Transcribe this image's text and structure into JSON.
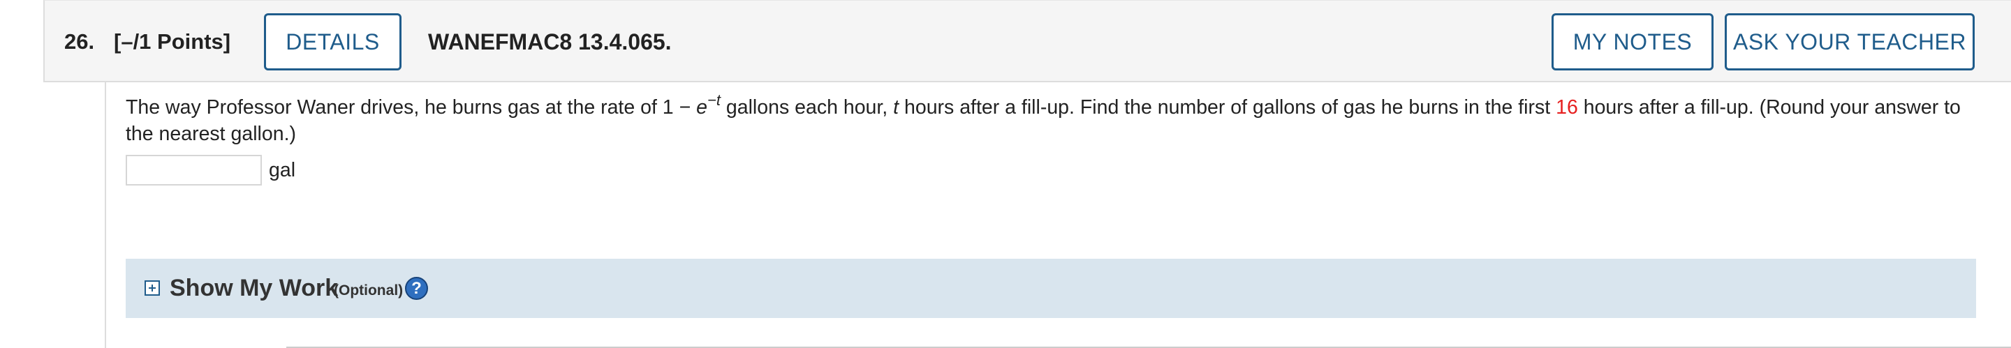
{
  "header": {
    "question_number": "26.",
    "points": "[–/1 Points]",
    "details_label": "DETAILS",
    "question_id": "WANEFMAC8 13.4.065.",
    "my_notes_label": "MY NOTES",
    "ask_teacher_label": "ASK YOUR TEACHER"
  },
  "question": {
    "text_part1": "The way Professor Waner drives, he burns gas at the rate of 1 − ",
    "e": "e",
    "exponent": "−t",
    "text_part2": " gallons each hour, ",
    "t": "t",
    "text_part3": " hours after a fill-up. Find the number of gallons of gas he burns in the first ",
    "highlight_value": "16",
    "text_part4": " hours after a fill-up. (Round your answer to the nearest gallon.)",
    "highlight_color": "#e62020"
  },
  "answer": {
    "value": "",
    "unit": "gal"
  },
  "show_work": {
    "label": "Show My Work",
    "optional": "(Optional)",
    "help_glyph": "?",
    "expand_icon": "plus-box-icon",
    "help_icon": "question-circle-icon"
  },
  "colors": {
    "accent": "#1f5c8b",
    "panel": "#d9e5ee",
    "header_bg": "#f5f5f5"
  }
}
